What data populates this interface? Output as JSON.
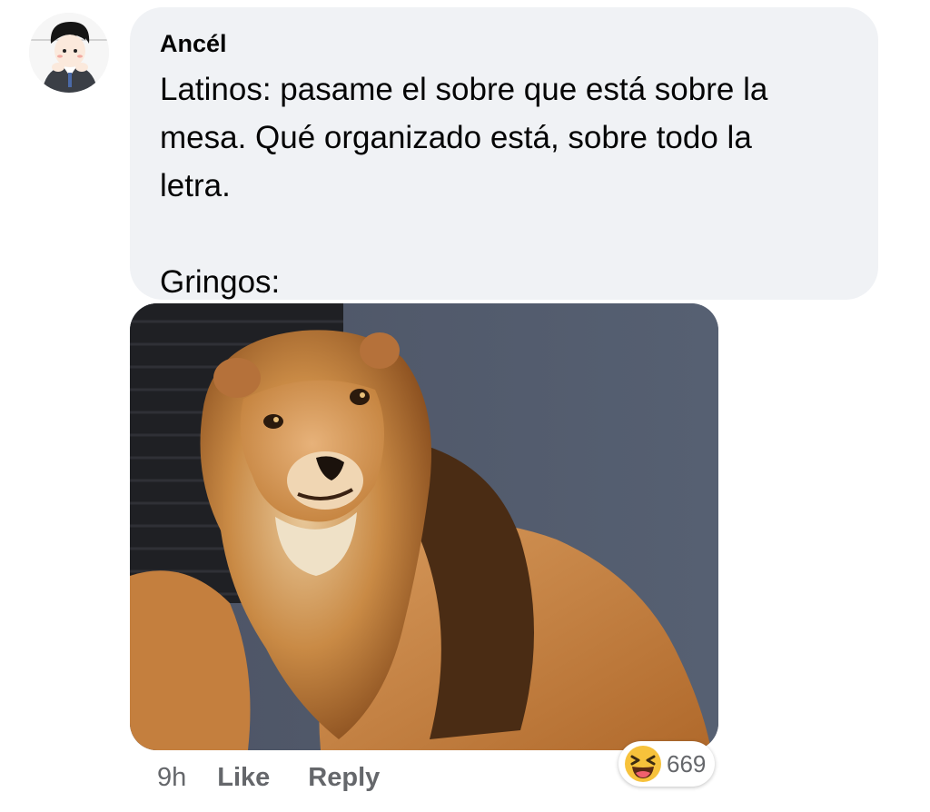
{
  "comment": {
    "author": "Ancél",
    "text": "Latinos: pasame el sobre que está sobre la\nmesa. Qué organizado está, sobre todo la\nletra.\n\nGringos:",
    "attachment": "lion-photo"
  },
  "footer": {
    "timestamp": "9h",
    "like_label": "Like",
    "reply_label": "Reply"
  },
  "reactions": {
    "icon": "haha-reaction-icon",
    "count": "669"
  },
  "colors": {
    "bubble": "#f0f2f5",
    "meta_text": "#65676b",
    "haha_yellow": "#f7c23b"
  }
}
